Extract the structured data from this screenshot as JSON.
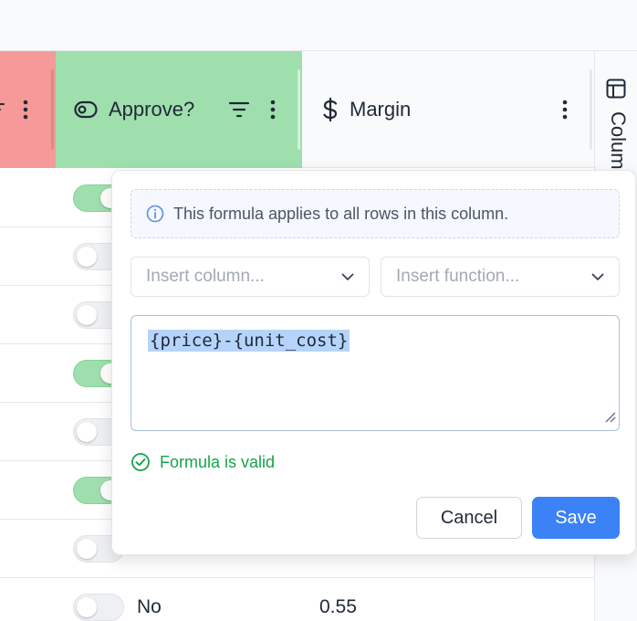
{
  "header": {
    "approve_title": "Approve?",
    "margin_title": "Margin"
  },
  "side_panel": {
    "label": "Columns"
  },
  "rows": [
    {
      "toggle_on": true,
      "label": "",
      "value": ""
    },
    {
      "toggle_on": false,
      "label": "",
      "value": ""
    },
    {
      "toggle_on": false,
      "label": "",
      "value": ""
    },
    {
      "toggle_on": true,
      "label": "",
      "value": ""
    },
    {
      "toggle_on": false,
      "label": "",
      "value": ""
    },
    {
      "toggle_on": true,
      "label": "",
      "value": ""
    },
    {
      "toggle_on": false,
      "label": "",
      "value": ""
    },
    {
      "toggle_on": false,
      "label": "No",
      "value": "0.55"
    }
  ],
  "popover": {
    "info_text": "This formula applies to all rows in this column.",
    "insert_column_placeholder": "Insert column...",
    "insert_function_placeholder": "Insert function...",
    "formula": "{price}-{unit_cost}",
    "valid_text": "Formula is valid",
    "cancel_label": "Cancel",
    "save_label": "Save"
  },
  "colors": {
    "red_header": "#f59a98",
    "green_header": "#9fdfae",
    "accent": "#3b82f6",
    "success": "#16a34a"
  },
  "icons": [
    "kebab-icon",
    "eye-toggle-icon",
    "filter-icon",
    "dollar-icon",
    "columns-icon",
    "info-icon",
    "chevron-down-icon",
    "check-circle-icon",
    "resize-handle-icon"
  ]
}
